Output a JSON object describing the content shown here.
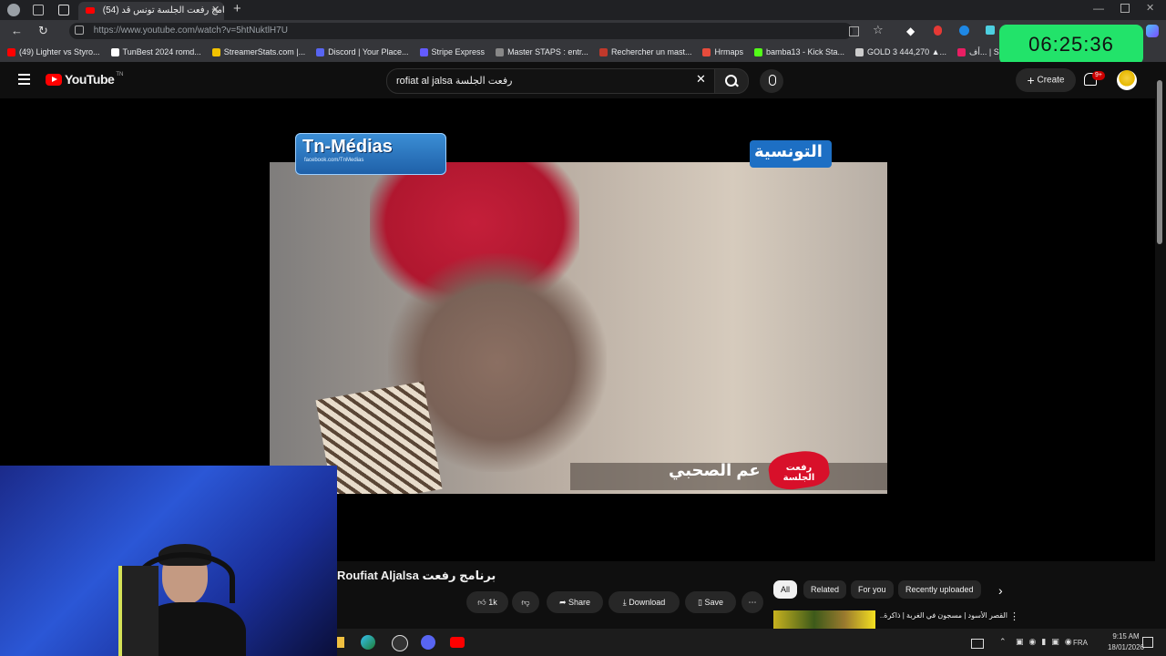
{
  "browser": {
    "tab_title": "(54) برنامج رفعت الجلسة تونس قد",
    "url": "https://www.youtube.com/watch?v=5htNuktlH7U",
    "bookmarks": [
      {
        "label": "(49) Lighter vs Styro...",
        "color": "#ff0000"
      },
      {
        "label": "TunBest 2024 romd...",
        "color": "#ffffff"
      },
      {
        "label": "StreamerStats.com |...",
        "color": "#f2c200"
      },
      {
        "label": "Discord | Your Place...",
        "color": "#5865f2"
      },
      {
        "label": "Stripe Express",
        "color": "#635bff"
      },
      {
        "label": "Master STAPS : entr...",
        "color": "#888888"
      },
      {
        "label": "Rechercher un mast...",
        "color": "#c0392b"
      },
      {
        "label": "Hrmaps",
        "color": "#e74c3c"
      },
      {
        "label": "bamba13 - Kick Sta...",
        "color": "#53fc18"
      },
      {
        "label": "GOLD 3 444,270 ▲...",
        "color": "#cccccc"
      },
      {
        "label": "أف... | Shofha - شوفها",
        "color": "#e91e63"
      }
    ]
  },
  "overlay": {
    "timer": "06:25:36"
  },
  "youtube": {
    "logo_text": "YouTube",
    "region": "TN",
    "search_value": "rofiat al jalsa رفعت الجلسة",
    "create_label": "Create",
    "notifications_badge": "9+"
  },
  "video": {
    "watermark_left": "Tn-Médias",
    "watermark_left_sub": "facebook.com/TnMedias",
    "channel_logo": "التونسية",
    "lower_third_name": "عم الصحبي",
    "lower_third_show": "رفعت الجلسة",
    "title": "Roufiat Aljalsa برنامج رفعت",
    "likes": "1k",
    "share_label": "Share",
    "download_label": "Download",
    "save_label": "Save"
  },
  "filters": [
    "All",
    "Related",
    "For you",
    "Recently uploaded"
  ],
  "recommendation": {
    "title": "القصر الأسود | مسجون في الغربة | ذاكرة..."
  },
  "taskbar": {
    "lang": "FRA",
    "time": "9:15 AM",
    "date": "18/01/2026"
  }
}
